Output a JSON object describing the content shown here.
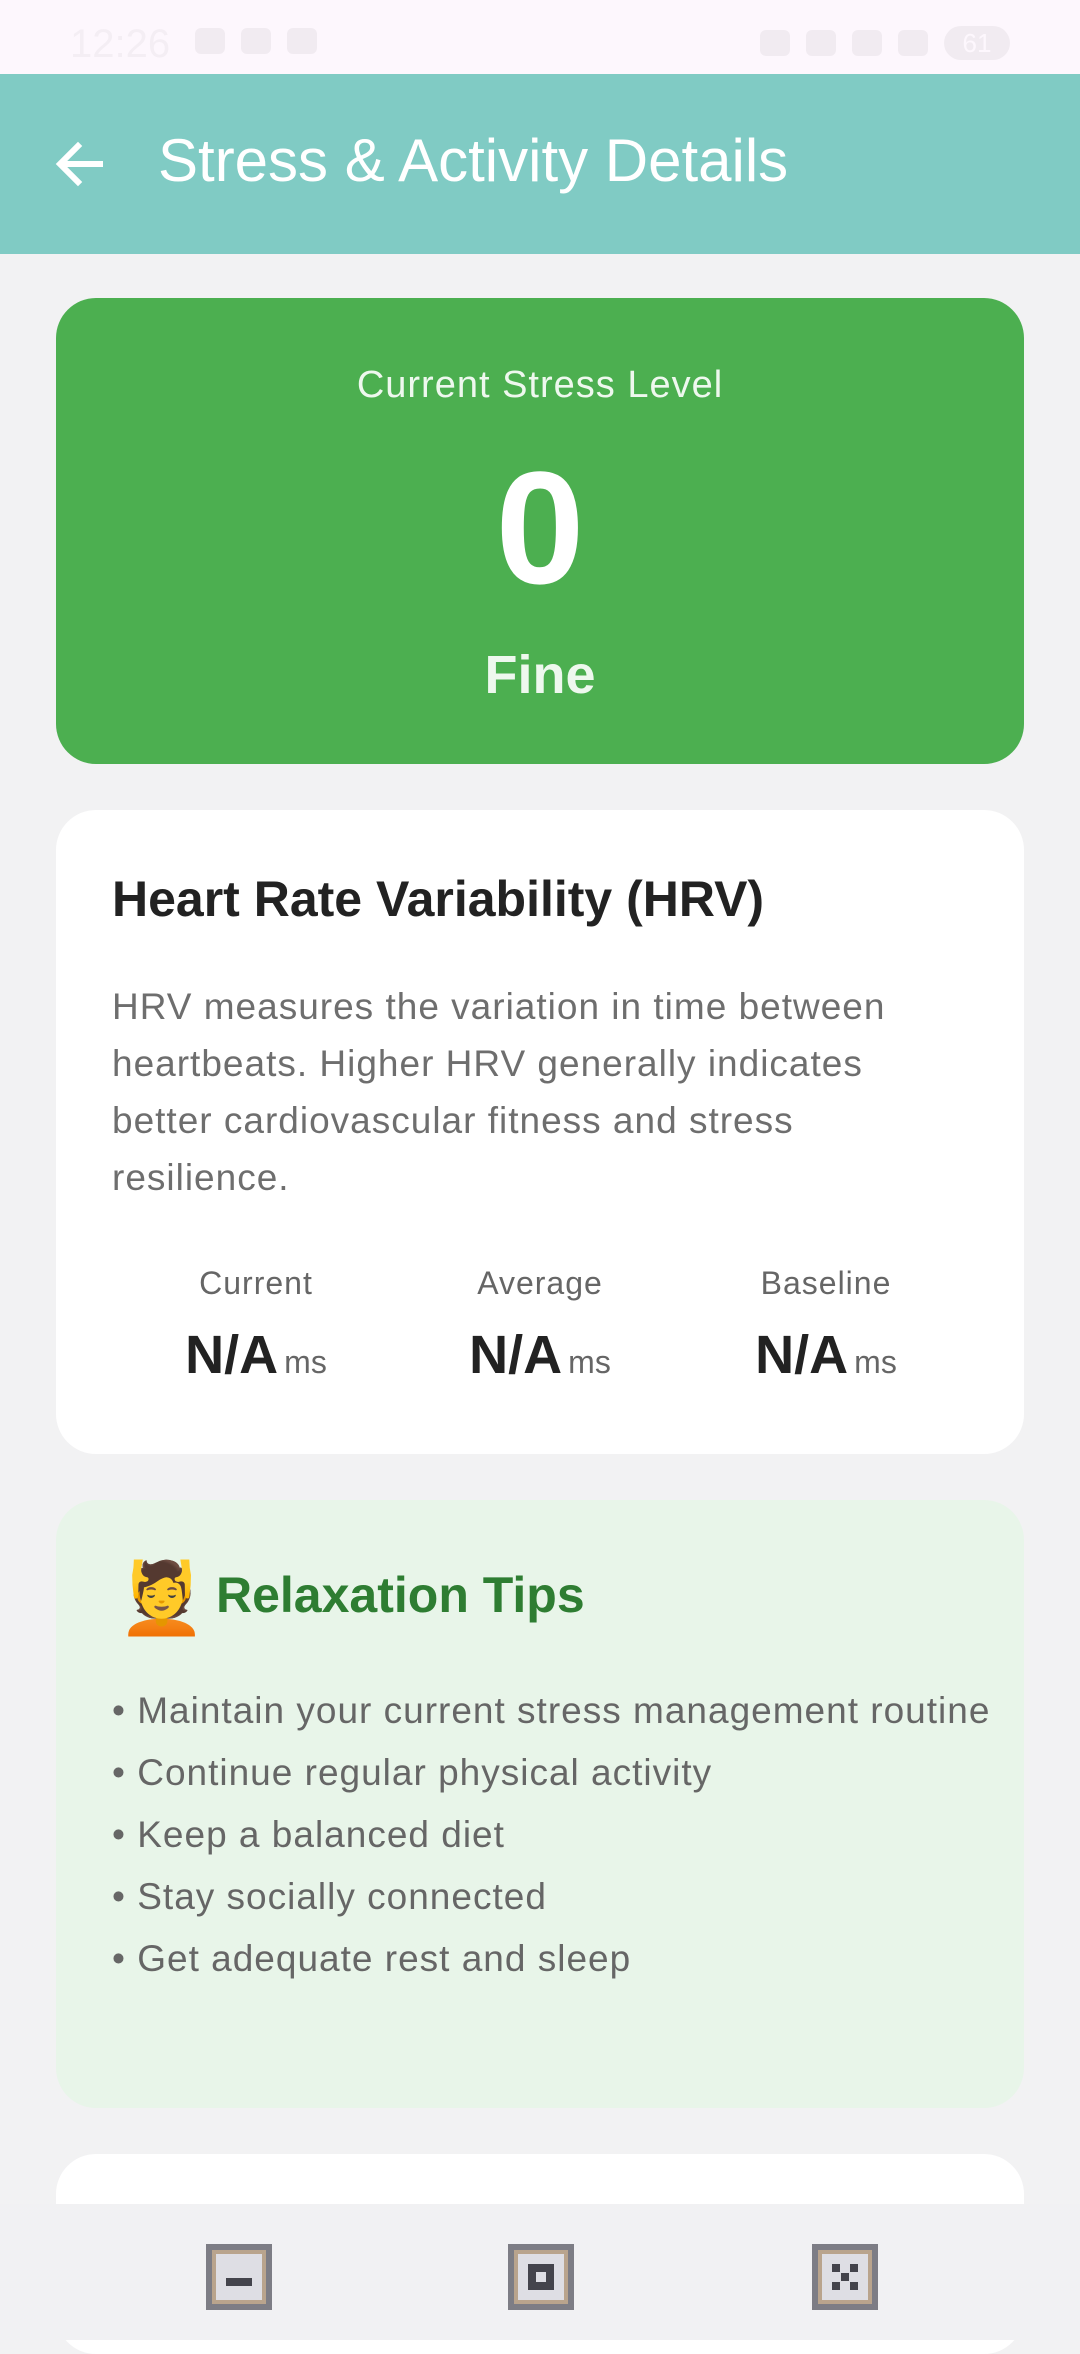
{
  "status_bar": {
    "time": "12:26",
    "battery": "61"
  },
  "app_bar": {
    "title": "Stress & Activity Details",
    "back_icon": "back-arrow-icon"
  },
  "stress_card": {
    "label": "Current Stress Level",
    "value": "0",
    "state": "Fine",
    "color": "#4caf50"
  },
  "hrv_card": {
    "title": "Heart Rate Variability (HRV)",
    "description": "HRV measures the variation in time between heartbeats. Higher HRV generally indicates better cardiovascular fitness and stress resilience.",
    "metrics": [
      {
        "label": "Current",
        "value": "N/A",
        "unit": "ms"
      },
      {
        "label": "Average",
        "value": "N/A",
        "unit": "ms"
      },
      {
        "label": "Baseline",
        "value": "N/A",
        "unit": "ms"
      }
    ]
  },
  "tips_card": {
    "icon": "person-getting-massage-icon",
    "emoji": "💆",
    "title": "Relaxation Tips",
    "items": [
      "• Maintain your current stress management routine",
      "• Continue regular physical activity",
      "• Keep a balanced diet",
      "• Stay socially connected",
      "• Get adequate rest and sleep"
    ],
    "title_color": "#2e7d32",
    "background": "#e8f5e9"
  },
  "colors": {
    "app_bar": "#80cbc4",
    "page_background": "#f2f2f3"
  }
}
